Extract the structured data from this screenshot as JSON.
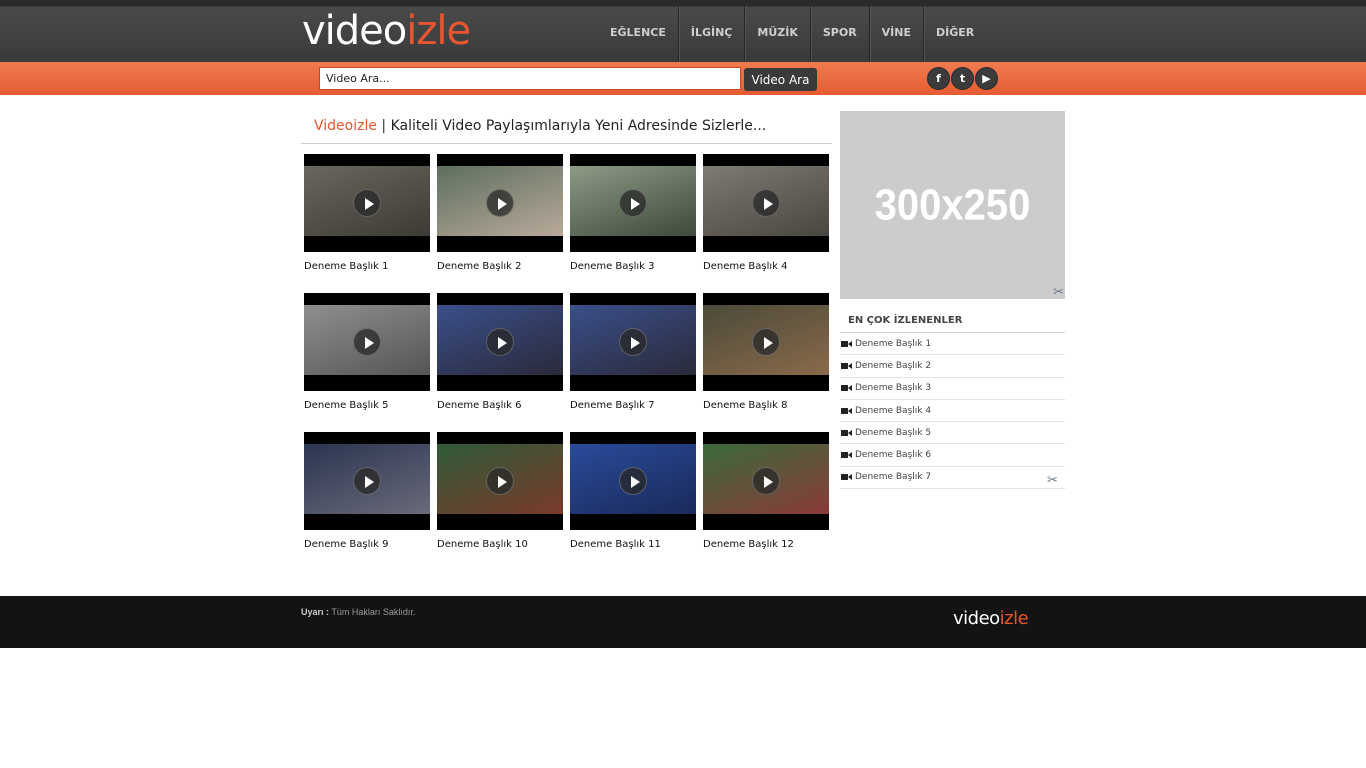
{
  "header": {
    "logo_part1": "video",
    "logo_part2": "izle",
    "nav": [
      "EĞLENCE",
      "İLGİNÇ",
      "MÜZİK",
      "SPOR",
      "VİNE",
      "DİĞER"
    ]
  },
  "search": {
    "placeholder": "Video Ara...",
    "button_label": "Video Ara"
  },
  "social": [
    {
      "icon": "facebook-icon",
      "glyph": "f"
    },
    {
      "icon": "twitter-icon",
      "glyph": "t"
    },
    {
      "icon": "youtube-icon",
      "glyph": "▶"
    }
  ],
  "main": {
    "heading_brand": "Videoizle",
    "heading_separator": "|",
    "heading_tagline": "Kaliteli Video Paylaşımlarıyla Yeni Adresinde Sizlerle...",
    "videos": [
      {
        "title": "Deneme Başlık 1",
        "colors": [
          "#6b665d",
          "#3d3a35"
        ]
      },
      {
        "title": "Deneme Başlık 2",
        "colors": [
          "#5d6f5e",
          "#b9a99a"
        ]
      },
      {
        "title": "Deneme Başlık 3",
        "colors": [
          "#8c9a86",
          "#3e4a3a"
        ]
      },
      {
        "title": "Deneme Başlık 4",
        "colors": [
          "#7f7a72",
          "#494540"
        ]
      },
      {
        "title": "Deneme Başlık 5",
        "colors": [
          "#8f8f8f",
          "#555555"
        ]
      },
      {
        "title": "Deneme Başlık 6",
        "colors": [
          "#3a4f8a",
          "#2a2a3a"
        ]
      },
      {
        "title": "Deneme Başlık 7",
        "colors": [
          "#3a4f8a",
          "#2a2a3a"
        ]
      },
      {
        "title": "Deneme Başlık 8",
        "colors": [
          "#4b4a3a",
          "#8a6a4a"
        ]
      },
      {
        "title": "Deneme Başlık 9",
        "colors": [
          "#2a3550",
          "#6a6a7a"
        ]
      },
      {
        "title": "Deneme Başlık 10",
        "colors": [
          "#2f5a3a",
          "#7a3a2a"
        ]
      },
      {
        "title": "Deneme Başlık 11",
        "colors": [
          "#2a4a9a",
          "#1a2a5a"
        ]
      },
      {
        "title": "Deneme Başlık 12",
        "colors": [
          "#3a6a3a",
          "#8a3a3a"
        ]
      }
    ]
  },
  "sidebar": {
    "ad_label": "300x250",
    "popular_title": "EN ÇOK İZLENENLER",
    "popular": [
      "Deneme Başlık 1",
      "Deneme Başlık 2",
      "Deneme Başlık 3",
      "Deneme Başlık 4",
      "Deneme Başlık 5",
      "Deneme Başlık 6",
      "Deneme Başlık 7"
    ]
  },
  "footer": {
    "warning_label": "Uyarı :",
    "warning_text": " Tüm Hakları Saklıdır.",
    "logo_part1": "video",
    "logo_part2": "izle"
  },
  "colors": {
    "accent": "#e8552f",
    "header_bg": "#3a3a3a",
    "footer_bg": "#131313",
    "ad_bg": "#cccccc"
  }
}
